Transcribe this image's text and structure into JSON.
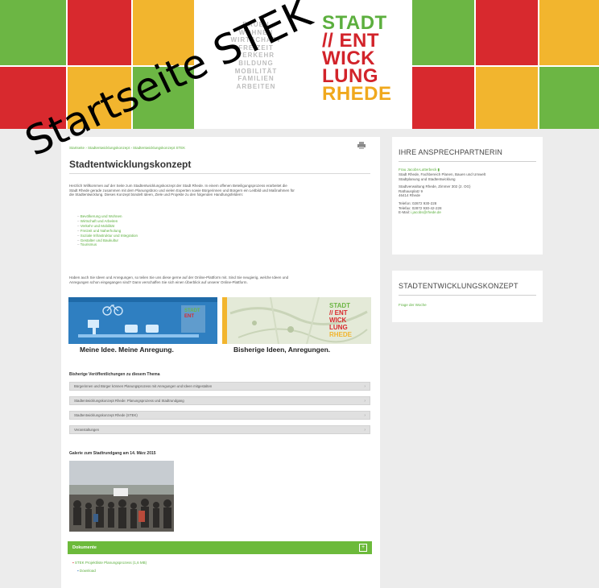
{
  "header": {
    "words": [
      "BAUEN",
      "WOHNEN",
      "WIRTSCHAFT",
      "FREIZEIT",
      "VERKEHR",
      "BILDUNG",
      "MOBILITÄT",
      "FAMILIEN",
      "ARBEITEN"
    ],
    "logo": {
      "line1": "STADT",
      "line2": "// ENT",
      "line3": "WICK",
      "line4": "LUNG",
      "line5": "RHEDE"
    },
    "tile_colors": {
      "green": "#6cb644",
      "red": "#d8292e",
      "orange": "#f2b52e"
    }
  },
  "main": {
    "breadcrumb": "Startseite › Stadtentwicklungskonzept › Stadtentwicklungskonzept STEK",
    "title": "Stadtentwicklungskonzept",
    "intro_lines": [
      "Herzlich Willkommen auf der Seite zum Stadtentwicklungskonzept der Stadt Rhede. In einem offenen Beteiligungsprozess erarbeitet die",
      "Stadt Rhede gerade zusammen mit dem Planungsbüro und vielen Experten sowie Bürgerinnen und Bürgern ein Leitbild und Maßnahmen für",
      "die Stadtentwicklung. Dieses Konzept bündelt Ideen, Ziele und Projekte zu den folgenden Handlungsfeldern:"
    ],
    "bullets": [
      "Bevölkerung und Wohnen",
      "Wirtschaft und Arbeiten",
      "Verkehr und Mobilität",
      "Freizeit und Naherholung",
      "Soziale Infrastruktur und Integration",
      "Gestalter und Baukultur",
      "Tourismus"
    ],
    "call_lines": [
      "Haben auch Sie Ideen und Anregungen, so teilen Sie uns diese gerne auf der Online-Plattform mit. Sind Sie neugierig, welche Ideen und",
      "Anregungen schon eingegangen sind? Dann verschaffen Sie sich einen Überblick auf unserer Online-Plattform."
    ],
    "banner_left": {
      "label": "Meine Idee. Meine Anregung."
    },
    "banner_right": {
      "label": "Bisherige Ideen, Anregungen.",
      "logo": [
        "STADT",
        "// ENT",
        "WICK",
        "LUNG",
        "RHEDE"
      ]
    },
    "publications_heading": "Bisherige Veröffentlichungen zu diesem Thema",
    "accordion": [
      "Bürgerinnen und Bürger können Planungsprozess mit Anregungen und Ideen mitgestalten",
      "Stadtentwicklungskonzept Rhede: Planungsprozess und Stadtrundgang",
      "Stadtentwicklungskonzept Rhede (STEK)",
      "Veranstaltungen"
    ],
    "event_heading": "Galerie zum Stadtrundgang am 14. März 2015",
    "documents_label": "Dokumente",
    "documents_plus": "+",
    "document_link": "STEK Projektliste Planungsprozess (1,6 MB)",
    "download_label": "Download"
  },
  "sidebar": {
    "contact_title": "IHRE ANSPRECHPARTNERIN",
    "contact_name": "Frau Jacobs-Lutterbeck",
    "contact_lines": [
      "Stadt Rhede, Fachbereich Planen, Bauen und Umwelt",
      "Stadtplanung und Stadtentwicklung",
      "",
      "Stadtverwaltung Rhede, Zimmer 302 (2. OG)",
      "Rathausplatz 9",
      "46414 Rhede",
      "",
      "Telefon: 02872 930-228",
      "Telefax: 02872 930-42-228"
    ],
    "contact_email_label": "E-Mail: ",
    "contact_email": "i.jacobs@rhede.de",
    "concept_title": "STADTENTWICKLUNGSKONZEPT",
    "concept_link": "Frage der Woche"
  },
  "overlay": {
    "text": "Startseite STEK"
  }
}
